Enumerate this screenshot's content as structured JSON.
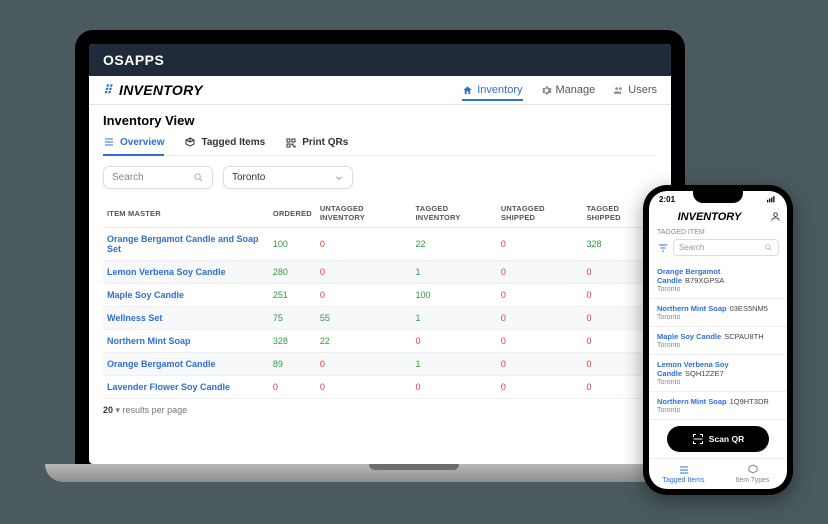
{
  "os_bar": {
    "prefix": "OS",
    "suffix": "APPS"
  },
  "app": {
    "logo": "INVENTORY",
    "nav": {
      "inventory": "Inventory",
      "manage": "Manage",
      "users": "Users"
    }
  },
  "page": {
    "title": "Inventory View",
    "tabs": {
      "overview": "Overview",
      "tagged": "Tagged Items",
      "print": "Print QRs"
    },
    "search_placeholder": "Search",
    "location": "Toronto"
  },
  "table": {
    "cols": [
      "ITEM MASTER",
      "ORDERED",
      "UNTAGGED INVENTORY",
      "TAGGED INVENTORY",
      "UNTAGGED SHIPPED",
      "TAGGED SHIPPED"
    ],
    "rows": [
      {
        "name": "Orange Bergamot Candle and Soap Set",
        "ordered": "100",
        "unt_inv": "0",
        "tag_inv": "22",
        "unt_ship": "0",
        "tag_ship": "328"
      },
      {
        "name": "Lemon Verbena Soy Candle",
        "ordered": "280",
        "unt_inv": "0",
        "tag_inv": "1",
        "unt_ship": "0",
        "tag_ship": "0"
      },
      {
        "name": "Maple Soy Candle",
        "ordered": "251",
        "unt_inv": "0",
        "tag_inv": "100",
        "unt_ship": "0",
        "tag_ship": "0"
      },
      {
        "name": "Wellness Set",
        "ordered": "75",
        "unt_inv": "55",
        "tag_inv": "1",
        "unt_ship": "0",
        "tag_ship": "0"
      },
      {
        "name": "Northern Mint Soap",
        "ordered": "328",
        "unt_inv": "22",
        "tag_inv": "0",
        "unt_ship": "0",
        "tag_ship": "0"
      },
      {
        "name": "Orange Bergamot Candle",
        "ordered": "89",
        "unt_inv": "0",
        "tag_inv": "1",
        "unt_ship": "0",
        "tag_ship": "0"
      },
      {
        "name": "Lavender Flower Soy Candle",
        "ordered": "0",
        "unt_inv": "0",
        "tag_inv": "0",
        "unt_ship": "0",
        "tag_ship": "0"
      }
    ],
    "pager_count": "20",
    "pager_label": "results per page"
  },
  "phone": {
    "time": "2:01",
    "logo": "INVENTORY",
    "sub": "TAGGED ITEM",
    "search_placeholder": "Search",
    "items": [
      {
        "name": "Orange Bergamot Candle",
        "code": "B79XGPSA",
        "loc": "Toronto"
      },
      {
        "name": "Northern Mint Soap",
        "code": "03ES5NM5",
        "loc": "Toronto"
      },
      {
        "name": "Maple Soy Candle",
        "code": "SCPAU8TH",
        "loc": "Toronto"
      },
      {
        "name": "Lemon Verbena Soy Candle",
        "code": "SQH1ZZE7",
        "loc": "Toronto"
      },
      {
        "name": "Northern Mint Soap",
        "code": "1Q9HT3DR",
        "loc": "Toronto"
      }
    ],
    "scan": "Scan QR",
    "tabs": {
      "tagged": "Tagged Items",
      "types": "Item Types"
    }
  }
}
